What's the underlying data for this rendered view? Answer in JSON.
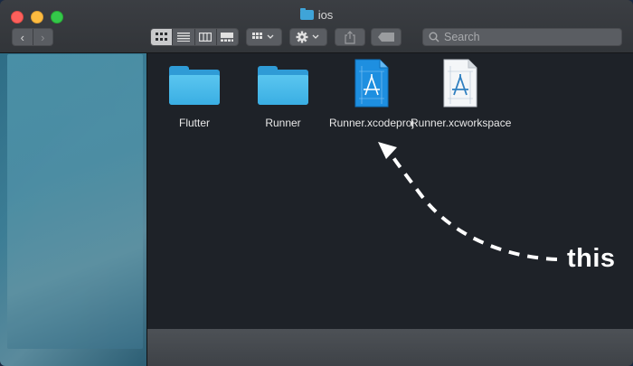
{
  "window": {
    "title": "ios"
  },
  "toolbar": {
    "back_glyph": "‹",
    "forward_glyph": "›",
    "search_placeholder": "Search"
  },
  "files": [
    {
      "name": "Flutter",
      "kind": "folder"
    },
    {
      "name": "Runner",
      "kind": "folder"
    },
    {
      "name": "Runner.xcodeproj",
      "kind": "xcodeproj"
    },
    {
      "name": "Runner.xcworkspace",
      "kind": "xcworkspace"
    }
  ],
  "annotation": {
    "text": "this"
  },
  "colors": {
    "folder": "#3aaee3",
    "xcodeproj": "#1e8fe0",
    "arrow": "#ffffff"
  }
}
